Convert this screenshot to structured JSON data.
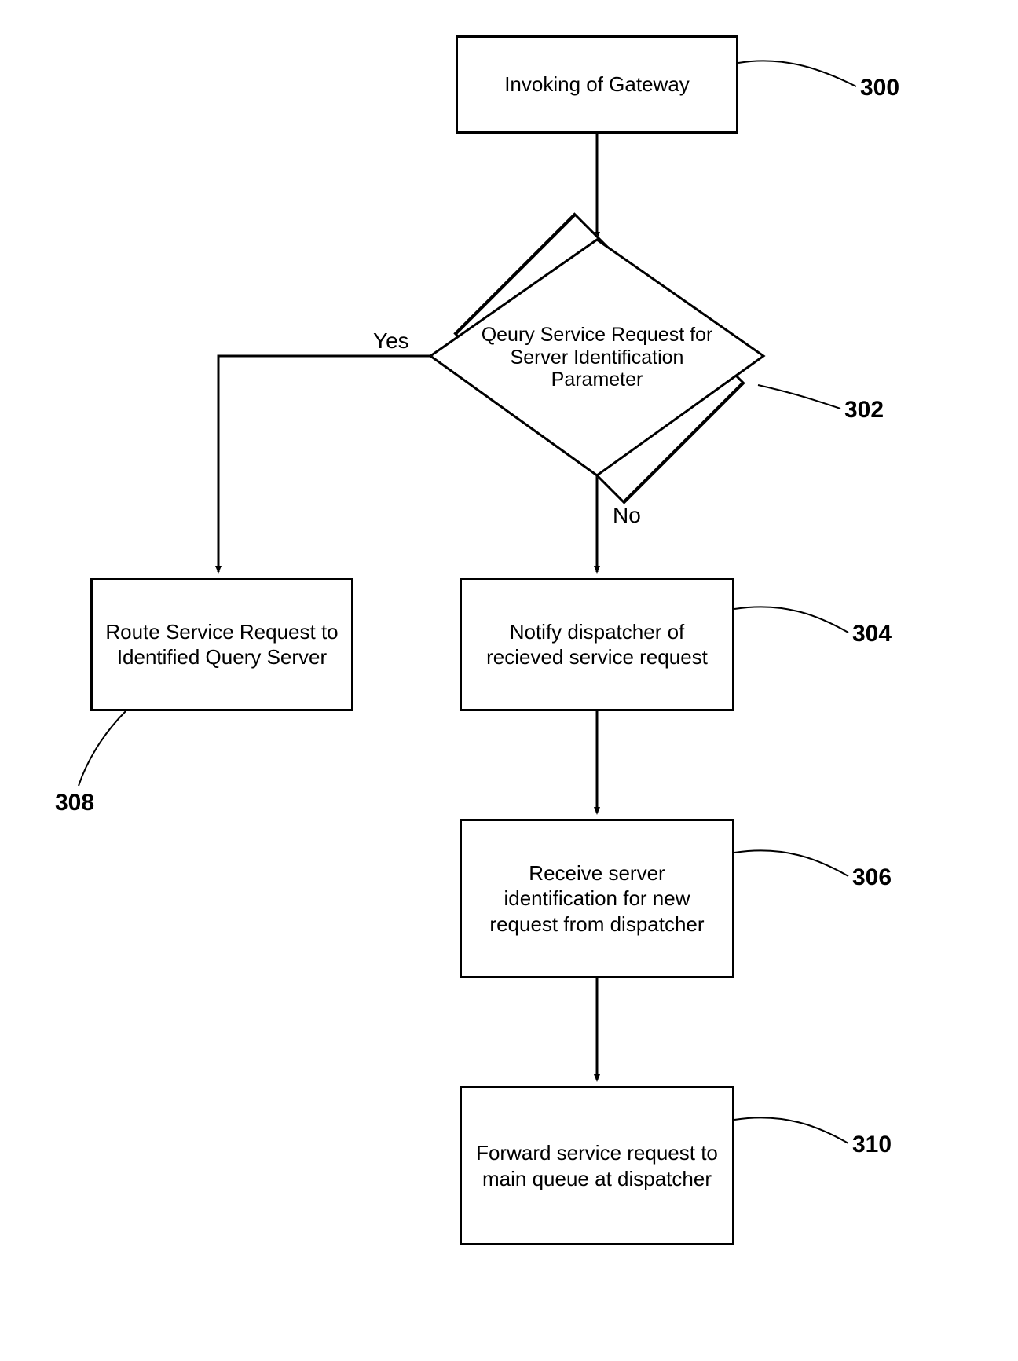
{
  "nodes": {
    "n300": {
      "text": "Invoking of  Gateway",
      "ref": "300"
    },
    "n302": {
      "text": "Qeury Service Request for Server Identification Parameter",
      "ref": "302"
    },
    "n304": {
      "text": "Notify dispatcher of recieved service request",
      "ref": "304"
    },
    "n306": {
      "text": "Receive server identification for new request from dispatcher",
      "ref": "306"
    },
    "n308": {
      "text": "Route Service Request to Identified Query Server",
      "ref": "308"
    },
    "n310": {
      "text": "Forward service request to main queue at dispatcher",
      "ref": "310"
    }
  },
  "edges": {
    "yes": "Yes",
    "no": "No"
  }
}
